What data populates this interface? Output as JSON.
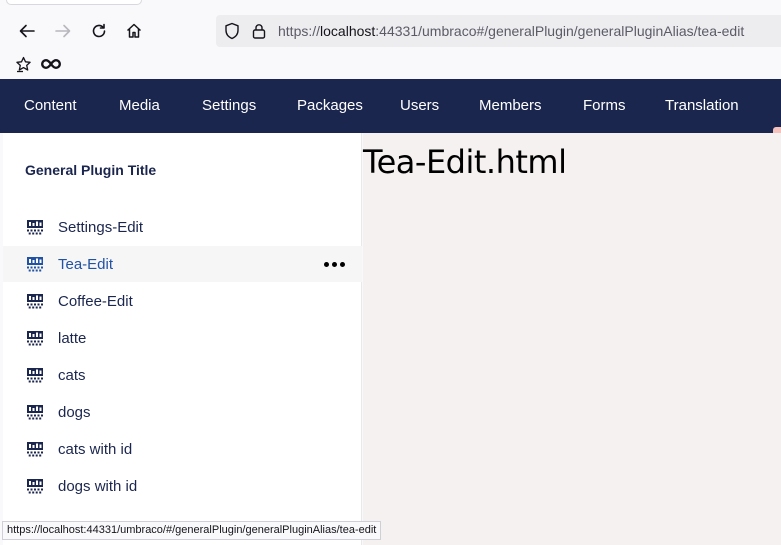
{
  "browser": {
    "url_prefix": "https://",
    "url_host": "localhost",
    "url_rest": ":44331/umbraco#/generalPlugin/generalPluginAlias/tea-edit",
    "status_url": "https://localhost:44331/umbraco/#/generalPlugin/generalPluginAlias/tea-edit",
    "icons": [
      "back-icon",
      "forward-icon",
      "reload-icon",
      "home-icon",
      "shield-icon",
      "lock-icon",
      "bookmark-star-icon",
      "infinity-icon"
    ]
  },
  "header": {
    "sections": [
      "Content",
      "Media",
      "Settings",
      "Packages",
      "Users",
      "Members",
      "Forms",
      "Translation"
    ],
    "colors": {
      "background": "#1b264f",
      "text": "#ffffff"
    }
  },
  "tree": {
    "title": "General Plugin Title",
    "items": [
      {
        "label": "Settings-Edit",
        "active": false
      },
      {
        "label": "Tea-Edit",
        "active": true
      },
      {
        "label": "Coffee-Edit",
        "active": false
      },
      {
        "label": "latte",
        "active": false
      },
      {
        "label": "cats",
        "active": false
      },
      {
        "label": "dogs",
        "active": false
      },
      {
        "label": "cats with id",
        "active": false
      },
      {
        "label": "dogs with id",
        "active": false
      }
    ],
    "colors": {
      "active_label": "#2152a3",
      "label": "#1b264f"
    }
  },
  "main": {
    "heading": "Tea-Edit.html"
  }
}
